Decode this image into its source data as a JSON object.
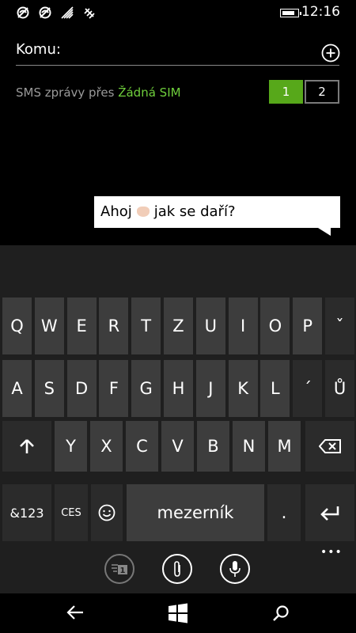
{
  "status_bar": {
    "time": "12:16",
    "icons": [
      "no-sim-icon",
      "no-sim-icon",
      "wifi-icon",
      "airplane-icon",
      "battery-icon"
    ],
    "battery_level": 0.75
  },
  "compose": {
    "to_label": "Komu:",
    "add_recipient_icon": "plus-circle-icon",
    "sim_prefix": "SMS zprávy přes",
    "sim_name": "Žádná SIM",
    "sim_options": [
      "1",
      "2"
    ],
    "sim_selected": "1",
    "accent_color": "#57a81a"
  },
  "message": {
    "text_before": "Ahoj",
    "text_after": "jak se daří?",
    "emoji": "waving-hand-emoji"
  },
  "keyboard": {
    "row1": [
      "Q",
      "W",
      "E",
      "R",
      "T",
      "Z",
      "U",
      "I",
      "O",
      "P",
      "ˇ"
    ],
    "row2": [
      "A",
      "S",
      "D",
      "F",
      "G",
      "H",
      "J",
      "K",
      "L",
      "´",
      "Ů"
    ],
    "row3": [
      "Y",
      "X",
      "C",
      "V",
      "B",
      "N",
      "M"
    ],
    "numbers_label": "&123",
    "language_label": "CES",
    "space_label": "mezerník",
    "period_label": ".",
    "shift_icon": "shift-arrow-icon",
    "backspace_icon": "backspace-icon",
    "enter_icon": "enter-icon",
    "emoji_icon": "smiley-icon"
  },
  "app_bar": {
    "buttons": [
      "sim-switch-icon",
      "attach-icon",
      "microphone-icon"
    ],
    "more_label": "•••"
  },
  "nav_bar": {
    "buttons": [
      "back-icon",
      "windows-start-icon",
      "search-icon"
    ]
  }
}
